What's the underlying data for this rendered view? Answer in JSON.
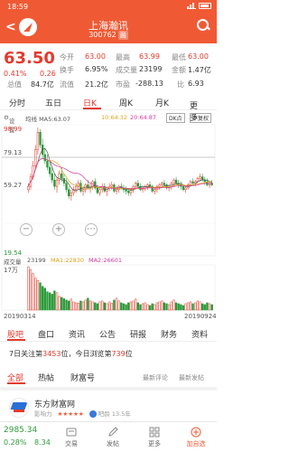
{
  "status": {
    "time": "18:59",
    "battery": ""
  },
  "header": {
    "title": "上海瀚讯",
    "code": "300762",
    "badge": "融"
  },
  "quote": {
    "price": "63.50",
    "pct": "0.41%",
    "chg": "0.26",
    "open_label": "今开",
    "open": "63.00",
    "high_label": "最高",
    "high": "63.99",
    "turnover_label": "换手",
    "turnover": "6.95%",
    "volume_label": "成交量",
    "volume": "23199",
    "total_label": "总值",
    "total": "84.7亿",
    "float_label": "流值",
    "float": "21.2亿",
    "pe_label": "市盈",
    "pe": "-288.13",
    "low_label": "最低",
    "low": "63.00",
    "amount_label": "金额",
    "amount": "1.47亿",
    "rate_label": "比",
    "rate": "6.93"
  },
  "tabs": [
    {
      "label": "分时"
    },
    {
      "label": "五日"
    },
    {
      "label": "日K",
      "active": true
    },
    {
      "label": "周K"
    },
    {
      "label": "月K"
    },
    {
      "label": "更多"
    }
  ],
  "legend": {
    "setting": "设置",
    "ma_label": "均线 MA5:63.07",
    "ma10": "10:64.32",
    "ma20": "20:64.87",
    "dk_label": "DK点",
    "adjust_label": "不复权"
  },
  "chart_data": {
    "type": "candlestick",
    "ylabels": [
      "98.99",
      "79.13",
      "59.27",
      "19.54"
    ],
    "dates": [
      "20190314",
      "20190924"
    ],
    "candles": [
      [
        60,
        64,
        58,
        62
      ],
      [
        62,
        70,
        60,
        68
      ],
      [
        68,
        78,
        66,
        75
      ],
      [
        75,
        88,
        72,
        85
      ],
      [
        85,
        99,
        82,
        96
      ],
      [
        96,
        98,
        86,
        88
      ],
      [
        88,
        92,
        80,
        82
      ],
      [
        82,
        86,
        76,
        78
      ],
      [
        78,
        82,
        72,
        74
      ],
      [
        74,
        78,
        68,
        70
      ],
      [
        70,
        74,
        64,
        66
      ],
      [
        66,
        70,
        60,
        62
      ],
      [
        62,
        68,
        58,
        66
      ],
      [
        66,
        72,
        63,
        70
      ],
      [
        70,
        74,
        65,
        67
      ],
      [
        67,
        70,
        62,
        64
      ],
      [
        64,
        67,
        58,
        60
      ],
      [
        60,
        62,
        54,
        56
      ],
      [
        56,
        60,
        53,
        58
      ],
      [
        58,
        62,
        56,
        60
      ],
      [
        60,
        64,
        58,
        62
      ],
      [
        62,
        66,
        60,
        64
      ],
      [
        64,
        66,
        58,
        59
      ],
      [
        59,
        62,
        56,
        60
      ],
      [
        60,
        64,
        58,
        63
      ],
      [
        63,
        66,
        60,
        61
      ],
      [
        61,
        64,
        58,
        62
      ],
      [
        62,
        66,
        60,
        65
      ],
      [
        65,
        67,
        60,
        61
      ],
      [
        61,
        63,
        57,
        58
      ],
      [
        58,
        62,
        56,
        60
      ],
      [
        60,
        64,
        58,
        62
      ],
      [
        62,
        64,
        58,
        59
      ],
      [
        59,
        62,
        56,
        61
      ],
      [
        61,
        64,
        59,
        62
      ],
      [
        62,
        65,
        60,
        63
      ],
      [
        63,
        64,
        58,
        59
      ],
      [
        59,
        62,
        57,
        60
      ],
      [
        60,
        63,
        58,
        62
      ],
      [
        62,
        64,
        60,
        61
      ],
      [
        61,
        63,
        58,
        60
      ],
      [
        60,
        62,
        57,
        59
      ],
      [
        59,
        61,
        56,
        58
      ],
      [
        58,
        61,
        56,
        60
      ],
      [
        60,
        63,
        58,
        62
      ],
      [
        62,
        65,
        60,
        64
      ],
      [
        64,
        66,
        61,
        62
      ],
      [
        62,
        64,
        59,
        60
      ],
      [
        60,
        62,
        58,
        61
      ],
      [
        61,
        63,
        59,
        62
      ],
      [
        62,
        64,
        60,
        63
      ],
      [
        63,
        65,
        61,
        62
      ],
      [
        62,
        63,
        58,
        59
      ],
      [
        59,
        61,
        57,
        60
      ],
      [
        60,
        63,
        58,
        62
      ],
      [
        62,
        64,
        60,
        63
      ],
      [
        63,
        65,
        61,
        64
      ],
      [
        64,
        66,
        62,
        63
      ],
      [
        63,
        64,
        60,
        61
      ],
      [
        61,
        63,
        59,
        62
      ],
      [
        62,
        65,
        60,
        64
      ],
      [
        64,
        67,
        62,
        66
      ],
      [
        66,
        68,
        63,
        64
      ],
      [
        64,
        66,
        61,
        63
      ],
      [
        63,
        65,
        60,
        62
      ],
      [
        62,
        63,
        59,
        60
      ],
      [
        60,
        62,
        58,
        61
      ],
      [
        61,
        64,
        60,
        63
      ],
      [
        63,
        66,
        62,
        65
      ],
      [
        65,
        67,
        63,
        64
      ],
      [
        64,
        66,
        62,
        65
      ],
      [
        65,
        68,
        64,
        67
      ],
      [
        67,
        70,
        65,
        68
      ],
      [
        68,
        70,
        65,
        66
      ],
      [
        66,
        68,
        63,
        65
      ],
      [
        65,
        67,
        62,
        63
      ],
      [
        63,
        65,
        61,
        64
      ],
      [
        64,
        66,
        62,
        63
      ]
    ],
    "volumes": [
      95,
      88,
      80,
      70,
      65,
      60,
      52,
      48,
      40,
      38,
      35,
      42,
      38,
      30,
      28,
      25,
      22,
      20,
      24,
      18,
      16,
      15,
      20,
      18,
      22,
      26,
      20,
      18,
      16,
      14,
      18,
      20,
      16,
      14,
      18,
      15,
      22,
      26,
      20,
      16,
      14,
      12,
      16,
      18,
      20,
      24,
      16,
      12,
      14,
      16,
      12,
      10,
      14,
      12,
      16,
      18,
      20,
      16,
      14,
      12,
      18,
      22,
      16,
      14,
      12,
      10,
      14,
      16,
      18,
      14,
      16,
      20,
      18,
      14,
      12,
      16,
      14,
      12
    ],
    "vol_scale_label": "17万",
    "price_min": 19.54,
    "price_max": 98.99
  },
  "volume_legend": {
    "label": "成交量",
    "value": "23199",
    "ma1": "MA1:22830",
    "ma2": "MA2:26601"
  },
  "zoom": {
    "minus": "−",
    "plus": "+",
    "dots": "⋯"
  },
  "news_tabs": [
    {
      "label": "股吧",
      "active": true
    },
    {
      "label": "盘口"
    },
    {
      "label": "资讯"
    },
    {
      "label": "公告"
    },
    {
      "label": "研报"
    },
    {
      "label": "财务"
    },
    {
      "label": "资料"
    }
  ],
  "follow": {
    "pre": "7日关注第",
    "rank1": "3453",
    "mid": "位，今日浏览第",
    "rank2": "739",
    "post": "位"
  },
  "board_tabs": [
    {
      "label": "全部",
      "active": true
    },
    {
      "label": "热帖"
    },
    {
      "label": "财富号"
    },
    {
      "label": "最新评论"
    },
    {
      "label": "最新发帖"
    }
  ],
  "post": {
    "name": "东方财富网",
    "influence": "影响力",
    "age": "吧龄 13.5年"
  },
  "bottom": {
    "index": "2985.34",
    "index_chg": "0.28%",
    "index_val": "8.34",
    "items": [
      {
        "label": "交易"
      },
      {
        "label": "发帖"
      },
      {
        "label": "更多"
      },
      {
        "label": "加自选"
      }
    ]
  }
}
